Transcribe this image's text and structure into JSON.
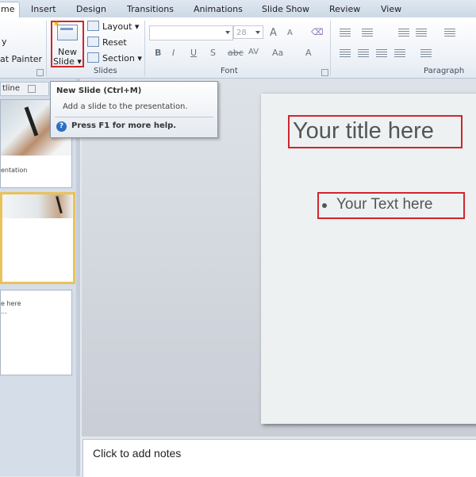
{
  "tabs": [
    {
      "label": "me",
      "active": true
    },
    {
      "label": "Insert"
    },
    {
      "label": "Design"
    },
    {
      "label": "Transitions"
    },
    {
      "label": "Animations"
    },
    {
      "label": "Slide Show"
    },
    {
      "label": "Review"
    },
    {
      "label": "View"
    }
  ],
  "clipboard": {
    "copy_label": "y",
    "painter_label": "at Painter"
  },
  "slides_group": {
    "label": "Slides",
    "new_slide_line1": "New",
    "new_slide_line2": "Slide",
    "layout_label": "Layout",
    "reset_label": "Reset",
    "section_label": "Section"
  },
  "font_group": {
    "label": "Font",
    "size_value": "28",
    "bold": "B",
    "italic": "I",
    "underline": "U",
    "shadow": "S",
    "strike": "abc",
    "spacing": "AV",
    "case": "Aa",
    "color": "A",
    "grow": "A",
    "shrink": "A"
  },
  "paragraph_group": {
    "label": "Paragraph"
  },
  "pane": {
    "tab_label": "tline",
    "thumb1_text": "entation",
    "thumb3_line1": "e here",
    "thumb3_line2": "..."
  },
  "slide": {
    "title": "Your title here",
    "body": "Your Text here"
  },
  "notes_placeholder": "Click to add notes",
  "tooltip": {
    "title": "New Slide (Ctrl+M)",
    "description": "Add a slide to the presentation.",
    "help": "Press F1 for more help."
  },
  "colors": {
    "highlight": "#d0262d",
    "selected_thumb": "#e8c35c",
    "help_icon": "#2c6fc1"
  }
}
